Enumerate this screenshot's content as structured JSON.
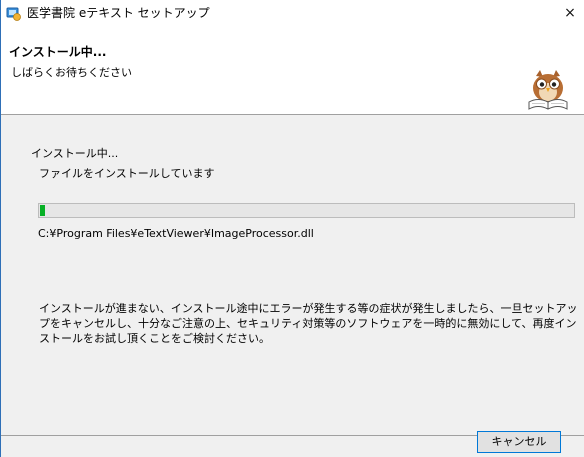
{
  "window": {
    "title": "医学書院 eテキスト セットアップ",
    "close_glyph": "×"
  },
  "header": {
    "title": "インストール中...",
    "subtitle": "しばらくお待ちください",
    "logo_icon": "owl-reading-book-icon"
  },
  "body": {
    "section_title": "インストール中...",
    "section_subtitle": "ファイルをインストールしています",
    "progress_fraction": 0.01,
    "file_path": "C:¥Program Files¥eTextViewer¥ImageProcessor.dll",
    "notice": "インストールが進まない、インストール途中にエラーが発生する等の症状が発生しましたら、一旦セットアップをキャンセルし、十分なご注意の上、セキュリティ対策等のソフトウェアを一時的に無効にして、再度インストールをお試し頂くことをご検討ください。"
  },
  "footer": {
    "cancel_label": "キャンセル"
  },
  "colors": {
    "progress_fill": "#06b025",
    "accent": "#0078d7"
  }
}
